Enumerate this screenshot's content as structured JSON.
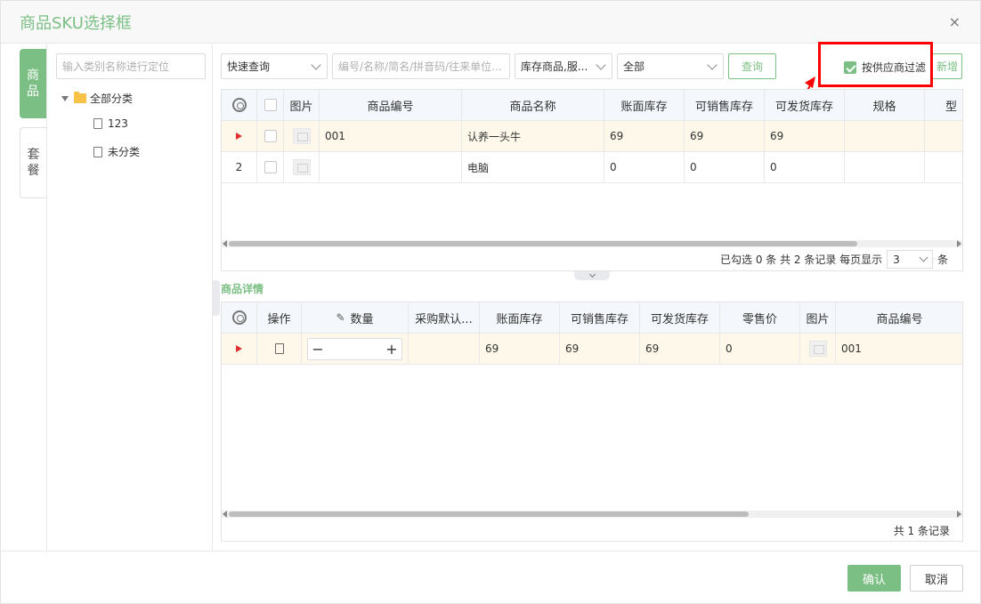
{
  "dialog": {
    "title": "商品SKU选择框",
    "close_glyph": "×"
  },
  "vtabs": {
    "active": "商品",
    "inactive": "套餐"
  },
  "tree": {
    "search_placeholder": "输入类别名称进行定位",
    "root": "全部分类",
    "children": [
      "123",
      "未分类"
    ]
  },
  "toolbar": {
    "quick_query": "快速查询",
    "keyword_placeholder": "编号/名称/简名/拼音码/往来单位...",
    "stock_type": "库存商品,服...",
    "range": "全部",
    "query_label": "查询",
    "supplier_filter_label": "按供应商过滤",
    "add_label": "新增"
  },
  "top_grid": {
    "headers": [
      "图片",
      "商品编号",
      "商品名称",
      "账面库存",
      "可销售库存",
      "可发货库存",
      "规格",
      "型"
    ],
    "rows": [
      {
        "index": "",
        "code": "001",
        "name": "认养一头牛",
        "book": "69",
        "sale": "69",
        "ship": "69"
      },
      {
        "index": "2",
        "code": "",
        "name": "电脑",
        "book": "0",
        "sale": "0",
        "ship": "0"
      }
    ],
    "pager": {
      "summary": "已勾选 0 条  共 2 条记录  每页显示",
      "page_size": "3",
      "unit": "条"
    }
  },
  "detail": {
    "section_title": "商品详情",
    "headers": [
      "操作",
      "数量",
      "采购默认...",
      "账面库存",
      "可销售库存",
      "可发货库存",
      "零售价",
      "图片",
      "商品编号"
    ],
    "rows": [
      {
        "book": "69",
        "sale": "69",
        "ship": "69",
        "retail": "0",
        "code": "001"
      }
    ],
    "footer": "共 1 条记录",
    "stepper_minus": "−",
    "stepper_plus": "+"
  },
  "footer": {
    "confirm": "确认",
    "cancel": "取消"
  },
  "colors": {
    "accent": "#7bbf84",
    "highlight": "#ff0000",
    "selected_row": "#fdf8e9"
  }
}
